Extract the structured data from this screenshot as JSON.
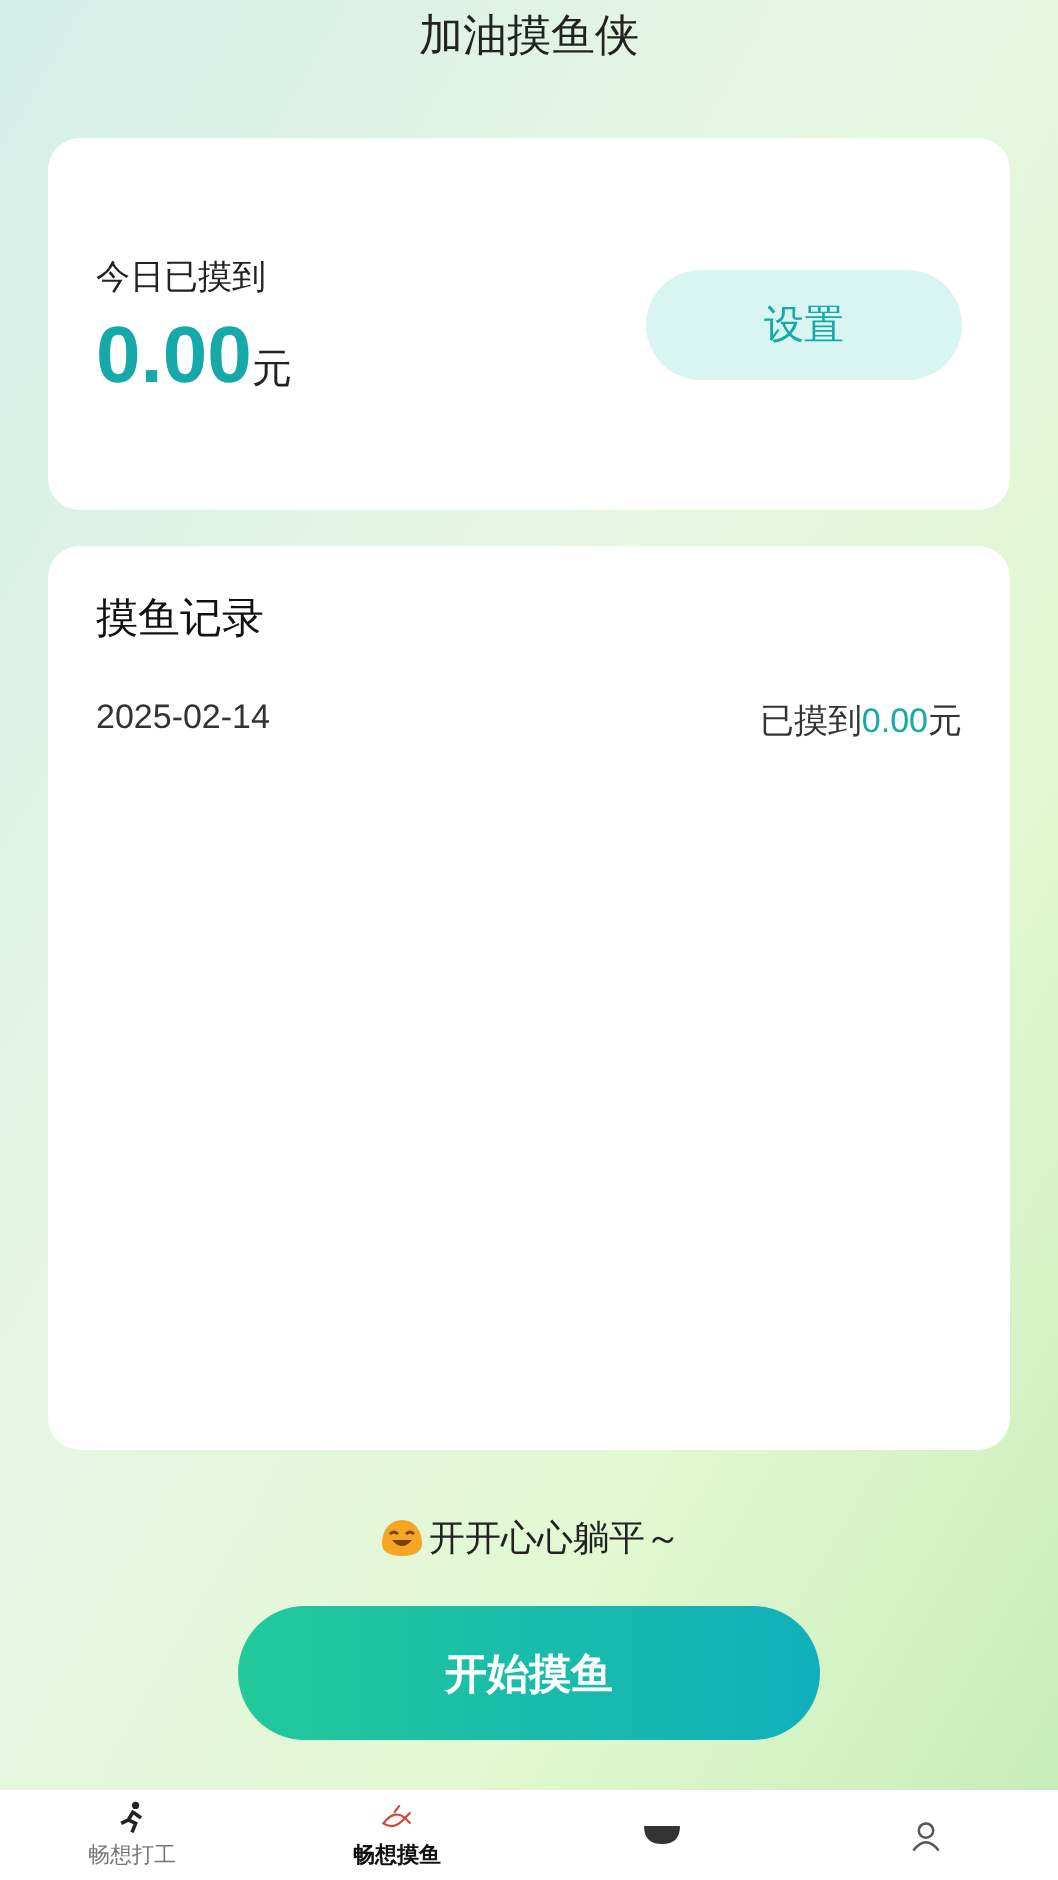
{
  "title": "加油摸鱼侠",
  "today": {
    "label": "今日已摸到",
    "amount": "0.00",
    "unit": "元",
    "settings_button": "设置"
  },
  "records": {
    "title": "摸鱼记录",
    "rows": [
      {
        "date": "2025-02-14",
        "prefix": "已摸到",
        "amount": "0.00",
        "unit": "元"
      }
    ]
  },
  "mood": "开开心心躺平～",
  "start_button": "开始摸鱼",
  "tabs": [
    {
      "label": "畅想打工",
      "selected": false,
      "kind": "runner"
    },
    {
      "label": "畅想摸鱼",
      "selected": true,
      "kind": "fish"
    },
    {
      "selected": false,
      "kind": "bowl"
    },
    {
      "selected": false,
      "kind": "person"
    }
  ]
}
